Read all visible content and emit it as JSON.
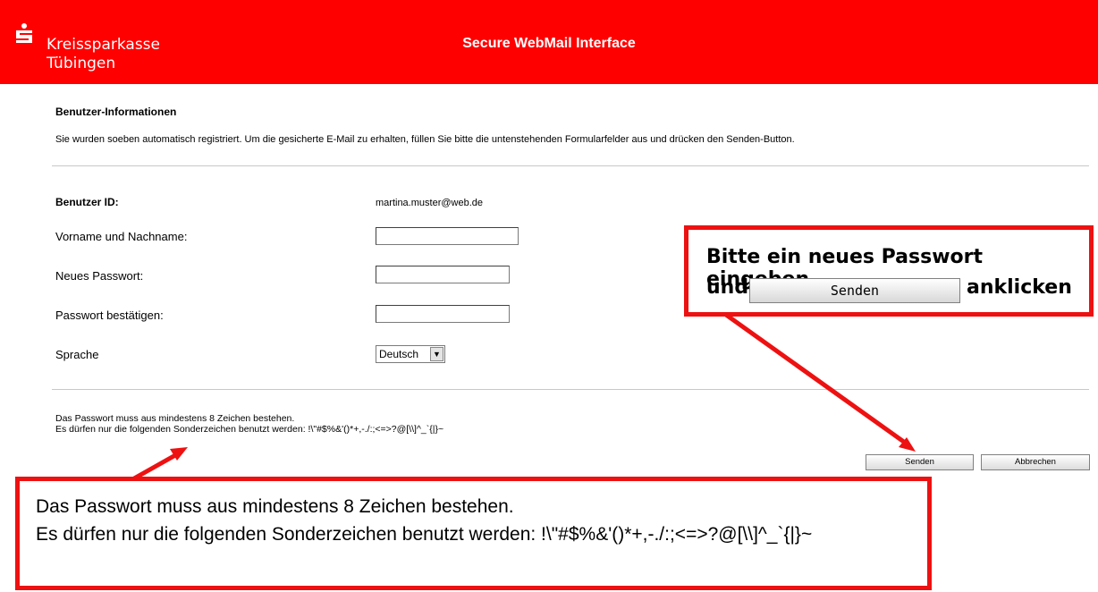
{
  "header": {
    "bank_line1": "Kreissparkasse",
    "bank_line2": "Tübingen",
    "title": "Secure WebMail Interface",
    "brand_color": "#ff0000",
    "logo_icon": "sparkasse-s-logo"
  },
  "section": {
    "title": "Benutzer-Informationen",
    "intro": "Sie wurden soeben automatisch registriert. Um die gesicherte E-Mail zu erhalten, füllen Sie bitte die untenstehenden Formularfelder aus und drücken den Senden-Button."
  },
  "form": {
    "user_id_label": "Benutzer ID:",
    "user_id_value": "martina.muster@web.de",
    "name_label": "Vorname und Nachname:",
    "name_value": "",
    "password_label": "Neues Passwort:",
    "password_value": "",
    "confirm_label": "Passwort bestätigen:",
    "confirm_value": "",
    "language_label": "Sprache",
    "language_value": "Deutsch"
  },
  "rules": {
    "line1": "Das Passwort muss aus mindestens 8 Zeichen bestehen.",
    "line2": "Es dürfen nur die folgenden Sonderzeichen benutzt werden: !\\\"#$%&'()*+,-./:;<=>?@[\\\\]^_`{|}~"
  },
  "buttons": {
    "send": "Senden",
    "cancel": "Abbrechen"
  },
  "callouts": {
    "top_line1": "Bitte ein neues Passwort eingeben",
    "top_und": "und",
    "top_button": "Senden",
    "top_anklicken": "anklicken",
    "bottom_line1": "Das Passwort muss aus mindestens 8 Zeichen bestehen.",
    "bottom_line2": "Es dürfen nur die folgenden Sonderzeichen benutzt werden: !\\\"#$%&'()*+,-./:;<=>?@[\\\\]^_`{|}~",
    "accent_color": "#ee1111"
  }
}
